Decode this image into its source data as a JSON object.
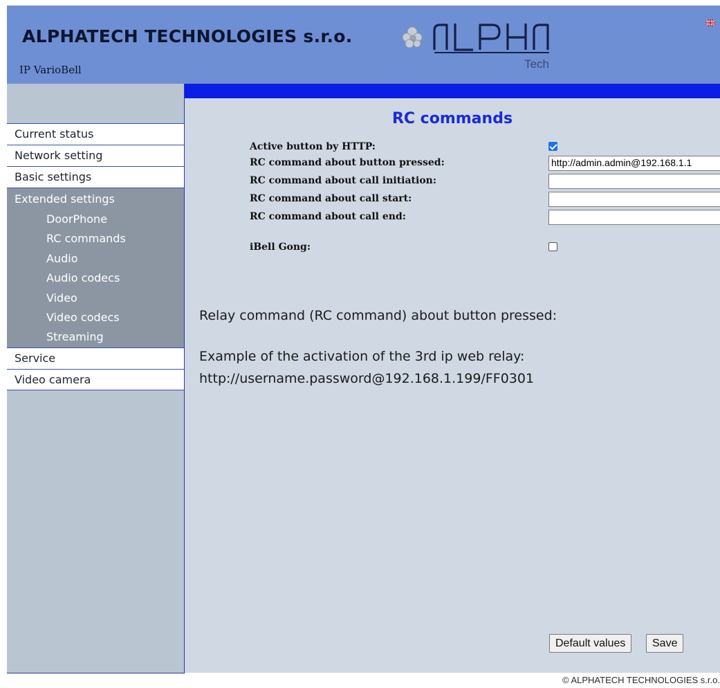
{
  "header": {
    "company": "ALPHATECH TECHNOLOGIES s.r.o.",
    "product": "IP VarioBell",
    "logo_text": "ALPHA",
    "logo_subtext": "Tech",
    "language_icon": "uk-flag-icon"
  },
  "sidebar": {
    "items": [
      {
        "label": "Current status"
      },
      {
        "label": "Network setting"
      },
      {
        "label": "Basic settings"
      }
    ],
    "group": {
      "label": "Extended settings",
      "children": [
        {
          "label": "DoorPhone"
        },
        {
          "label": "RC commands"
        },
        {
          "label": "Audio"
        },
        {
          "label": "Audio codecs"
        },
        {
          "label": "Video"
        },
        {
          "label": "Video codecs"
        },
        {
          "label": "Streaming"
        }
      ]
    },
    "bottom_items": [
      {
        "label": "Service"
      },
      {
        "label": "Video camera"
      }
    ]
  },
  "main": {
    "title": "RC commands",
    "fields": {
      "active_button": {
        "label": "Active button by HTTP:",
        "checked": true
      },
      "button_pressed": {
        "label": "RC command about button pressed:",
        "value": "http://admin.admin@192.168.1.1"
      },
      "call_initiation": {
        "label": "RC command about call initiation:",
        "value": ""
      },
      "call_start": {
        "label": "RC command about call start:",
        "value": ""
      },
      "call_end": {
        "label": "RC command about call end:",
        "value": ""
      },
      "ibell_gong": {
        "label": "iBell Gong:",
        "checked": false
      }
    },
    "help": {
      "line1": "Relay command (RC command) about button pressed:",
      "line2": "Example of the activation of the 3rd ip web relay:",
      "line3": "http://username.password@192.168.1.199/FF0301"
    },
    "buttons": {
      "default": "Default values",
      "save": "Save"
    }
  },
  "footer": {
    "copyright": "© ALPHATECH TECHNOLOGIES s.r.o."
  },
  "colors": {
    "header_bg": "#6f8fd4",
    "accent_bar": "#0a1ee6",
    "title": "#1a2bd6",
    "sidebar_bg": "#b9c5d1",
    "group_bg": "#8c96a3",
    "main_bg": "#cfd8e3"
  }
}
